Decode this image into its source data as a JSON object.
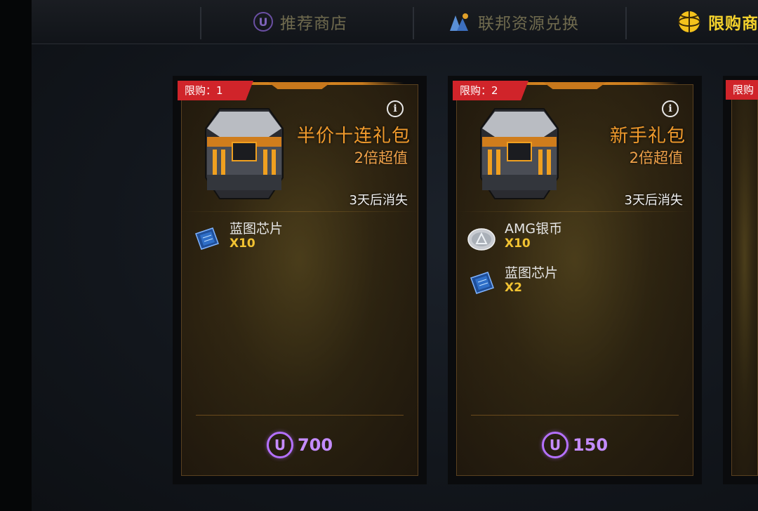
{
  "tabs": [
    {
      "label": "推荐商店",
      "icon": "u-currency-icon"
    },
    {
      "label": "联邦资源兑换",
      "icon": "resources-icon"
    },
    {
      "label": "限购商",
      "icon": "globe-icon"
    }
  ],
  "cards": [
    {
      "limit": "限购：1",
      "title": "半价十连礼包",
      "subtitle": "2倍超值",
      "expire": "3天后消失",
      "items": [
        {
          "name": "蓝图芯片",
          "qty": "X10",
          "icon": "blueprint-chip-icon"
        }
      ],
      "price": "700"
    },
    {
      "limit": "限购：2",
      "title": "新手礼包",
      "subtitle": "2倍超值",
      "expire": "3天后消失",
      "items": [
        {
          "name": "AMG银币",
          "qty": "X10",
          "icon": "silver-coin-icon"
        },
        {
          "name": "蓝图芯片",
          "qty": "X2",
          "icon": "blueprint-chip-icon"
        }
      ],
      "price": "150"
    }
  ],
  "partial_card": {
    "limit": "限购"
  },
  "colors": {
    "accent": "#f4d22c",
    "badge": "#d0242a",
    "title": "#f09a2c",
    "price": "#c48cff"
  }
}
